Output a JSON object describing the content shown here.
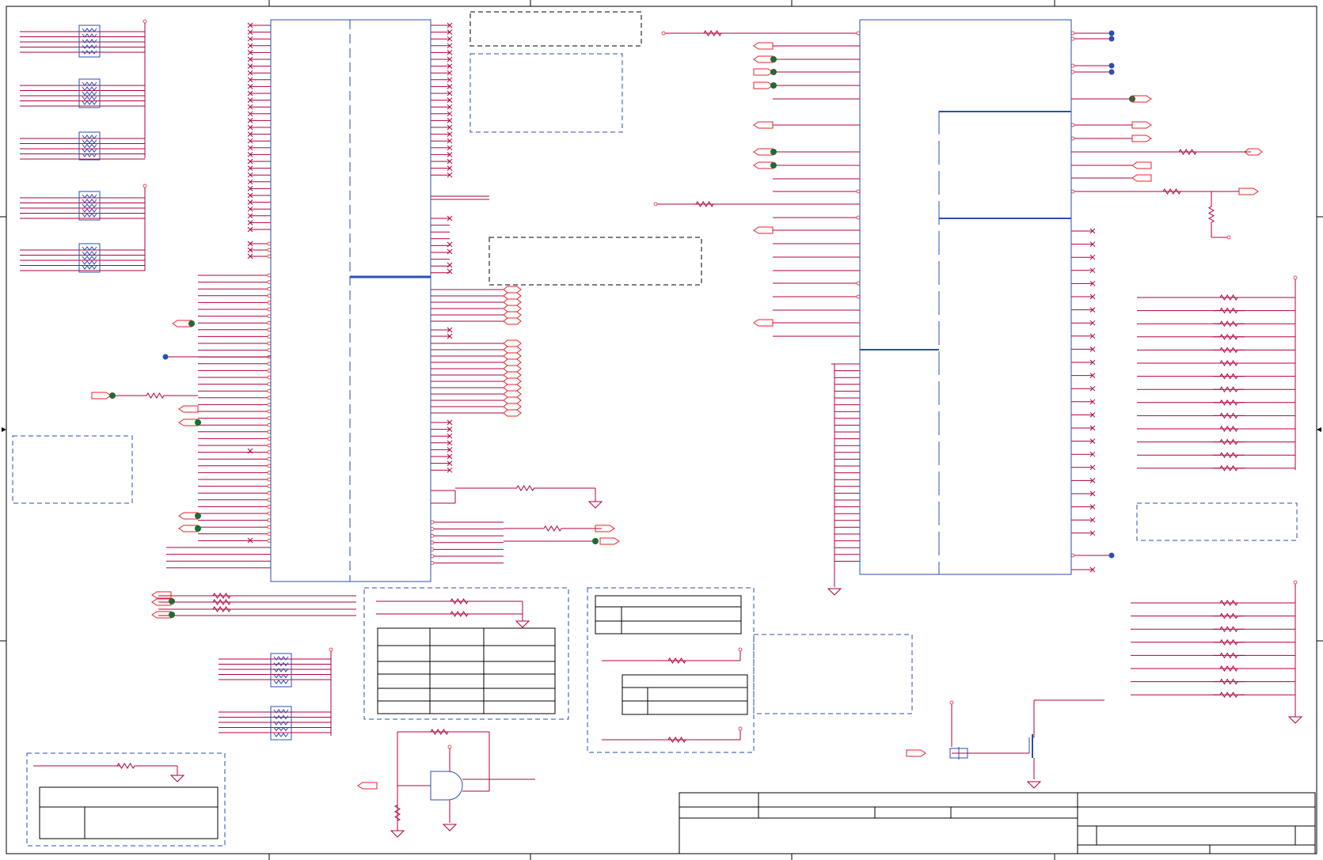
{
  "colors": {
    "background": "#ffffff",
    "frame": "#000000",
    "wire": "#b2003c",
    "pin": "#e8202a",
    "component": "#2b4fb0",
    "note_box": "#2b4fb0",
    "junction": "#1f6b34",
    "connector_dot": "#2b4fb0"
  },
  "icons": {
    "resistor": "resistor-symbol",
    "resistor_pack": "resistor-array-symbol",
    "ground": "ground-symbol",
    "no_connect": "no-connect-x-symbol",
    "port": "offpage-port-symbol",
    "and_gate": "and-gate-symbol",
    "mosfet": "mosfet-symbol"
  }
}
